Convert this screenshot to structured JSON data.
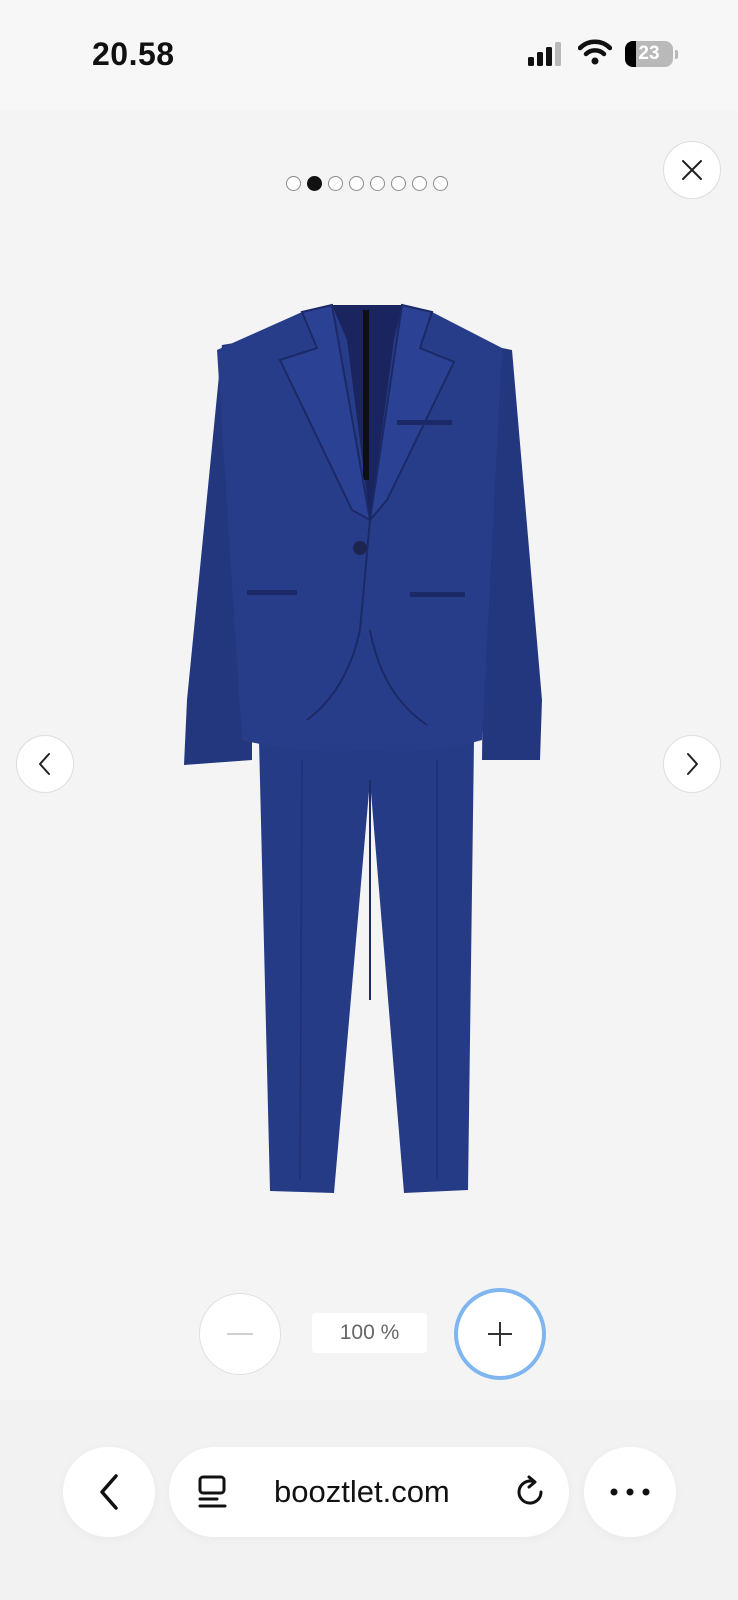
{
  "status_bar": {
    "time": "20.58",
    "battery_level": "23",
    "icons": [
      "cellular-signal-icon",
      "wifi-icon",
      "battery-icon"
    ]
  },
  "gallery": {
    "image_count": 8,
    "active_index": 1,
    "product_image": "navy-blue-suit-jacket-and-trousers",
    "icons": {
      "close": "close-icon",
      "prev": "chevron-left-icon",
      "next": "chevron-right-icon"
    }
  },
  "zoom": {
    "level_label": "100 %",
    "out_icon": "minus-icon",
    "in_icon": "plus-icon"
  },
  "browser": {
    "url": "booztlet.com",
    "icons": {
      "back": "chevron-left-icon",
      "tabs": "tab-overview-icon",
      "reload": "reload-icon",
      "more": "more-dots-icon"
    }
  },
  "colors": {
    "suit": "#263b86",
    "zoom_focus_ring": "#7fb6ef",
    "background": "#f4f4f5"
  }
}
